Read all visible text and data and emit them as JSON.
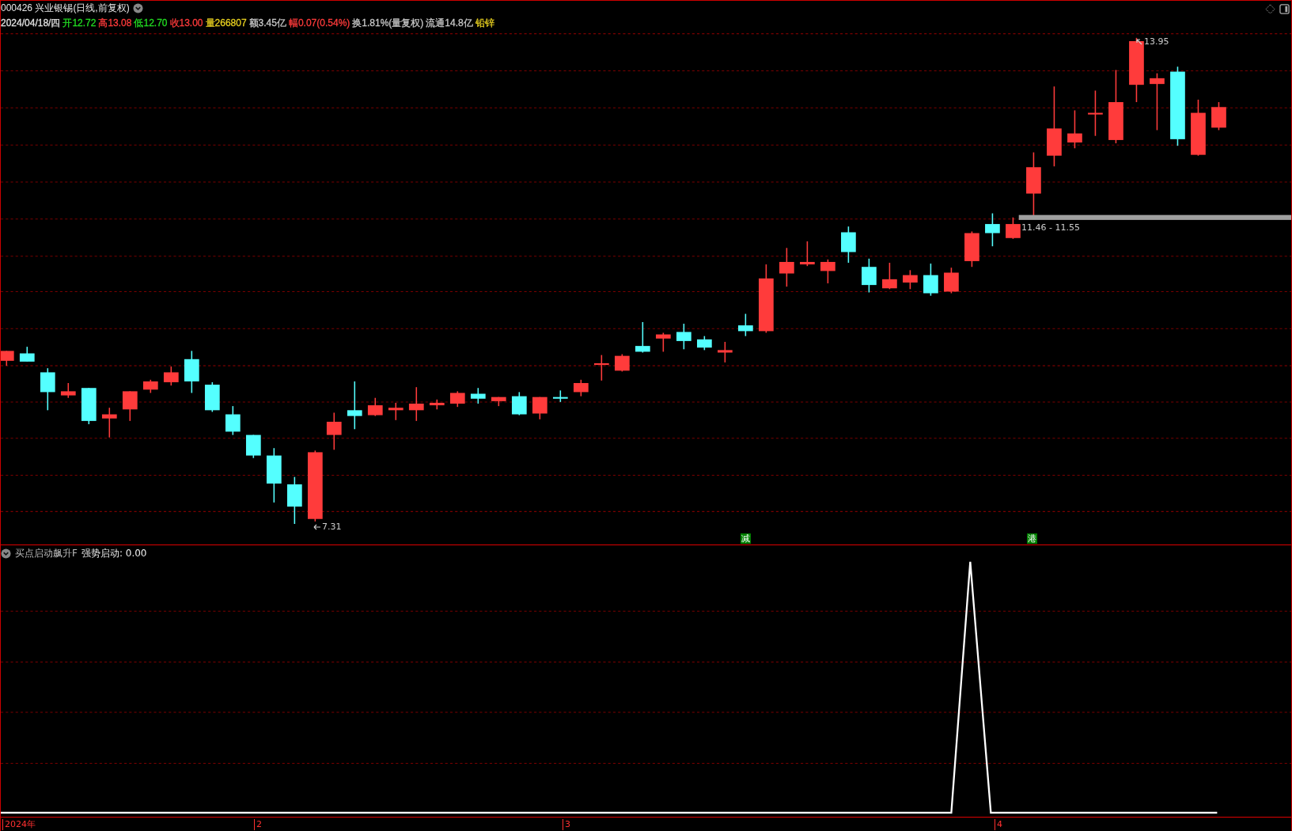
{
  "header": {
    "title": "000426 兴业银锡(日线,前复权)",
    "quote": [
      {
        "text": "2024/04/18/四",
        "color": "#e0e0e0"
      },
      {
        "text": "开12.72",
        "color": "#22dd22"
      },
      {
        "text": "高13.08",
        "color": "#ff3b3b"
      },
      {
        "text": "低12.70",
        "color": "#22dd22"
      },
      {
        "text": "收13.00",
        "color": "#ff3b3b"
      },
      {
        "text": "量266807",
        "color": "#e8d020"
      },
      {
        "text": "额3.45亿",
        "color": "#c8c8c8"
      },
      {
        "text": "幅0.07(0.54%)",
        "color": "#ff3b3b"
      },
      {
        "text": "换1.81%(量复权)",
        "color": "#c8c8c8"
      },
      {
        "text": "流通14.8亿",
        "color": "#c8c8c8"
      },
      {
        "text": "铅锌",
        "color": "#e8d020"
      }
    ]
  },
  "price_chart": {
    "high_label": "13.95",
    "low_label": "7.31",
    "zone_label": "11.46 - 11.55",
    "event_marks": [
      "减",
      "港"
    ]
  },
  "indicator": {
    "name": "买点启动飙升F",
    "value": "强势启动: 0.00"
  },
  "x_axis": {
    "labels": [
      "2024年",
      "2",
      "3",
      "4"
    ]
  }
}
